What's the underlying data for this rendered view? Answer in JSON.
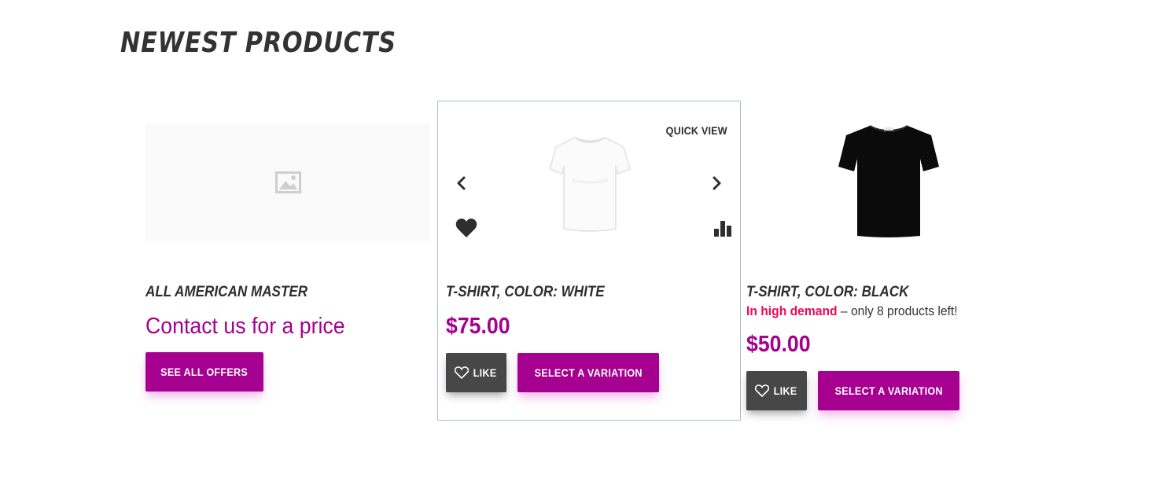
{
  "section": {
    "title": "NEWEST PRODUCTS"
  },
  "products": [
    {
      "name": "ALL AMERICAN MASTER",
      "image": "image-placeholder-icon",
      "price_text": "Contact us for a price",
      "button_label": "SEE ALL OFFERS"
    },
    {
      "name": "T-SHIRT, COLOR: WHITE",
      "image": "white-tshirt",
      "quick_view_label": "QUICK VIEW",
      "price": "$75.00",
      "like_label": "LIKE",
      "button_label": "SELECT A VARIATION"
    },
    {
      "name": "T-SHIRT, COLOR: BLACK",
      "image": "black-tshirt",
      "demand_strong": "In high demand",
      "demand_rest": " – only 8 products left!",
      "price": "$50.00",
      "like_label": "LIKE",
      "button_label": "SELECT A VARIATION"
    }
  ],
  "icons": {
    "prev": "chevron-left-icon",
    "next": "chevron-right-icon",
    "wishlist": "heart-icon",
    "compare": "bar-chart-icon",
    "like": "heart-outline-icon"
  },
  "colors": {
    "accent": "#a5008f",
    "demand": "#ee0a58",
    "dark_button": "#474747",
    "hover_border": "#a9bccc"
  }
}
